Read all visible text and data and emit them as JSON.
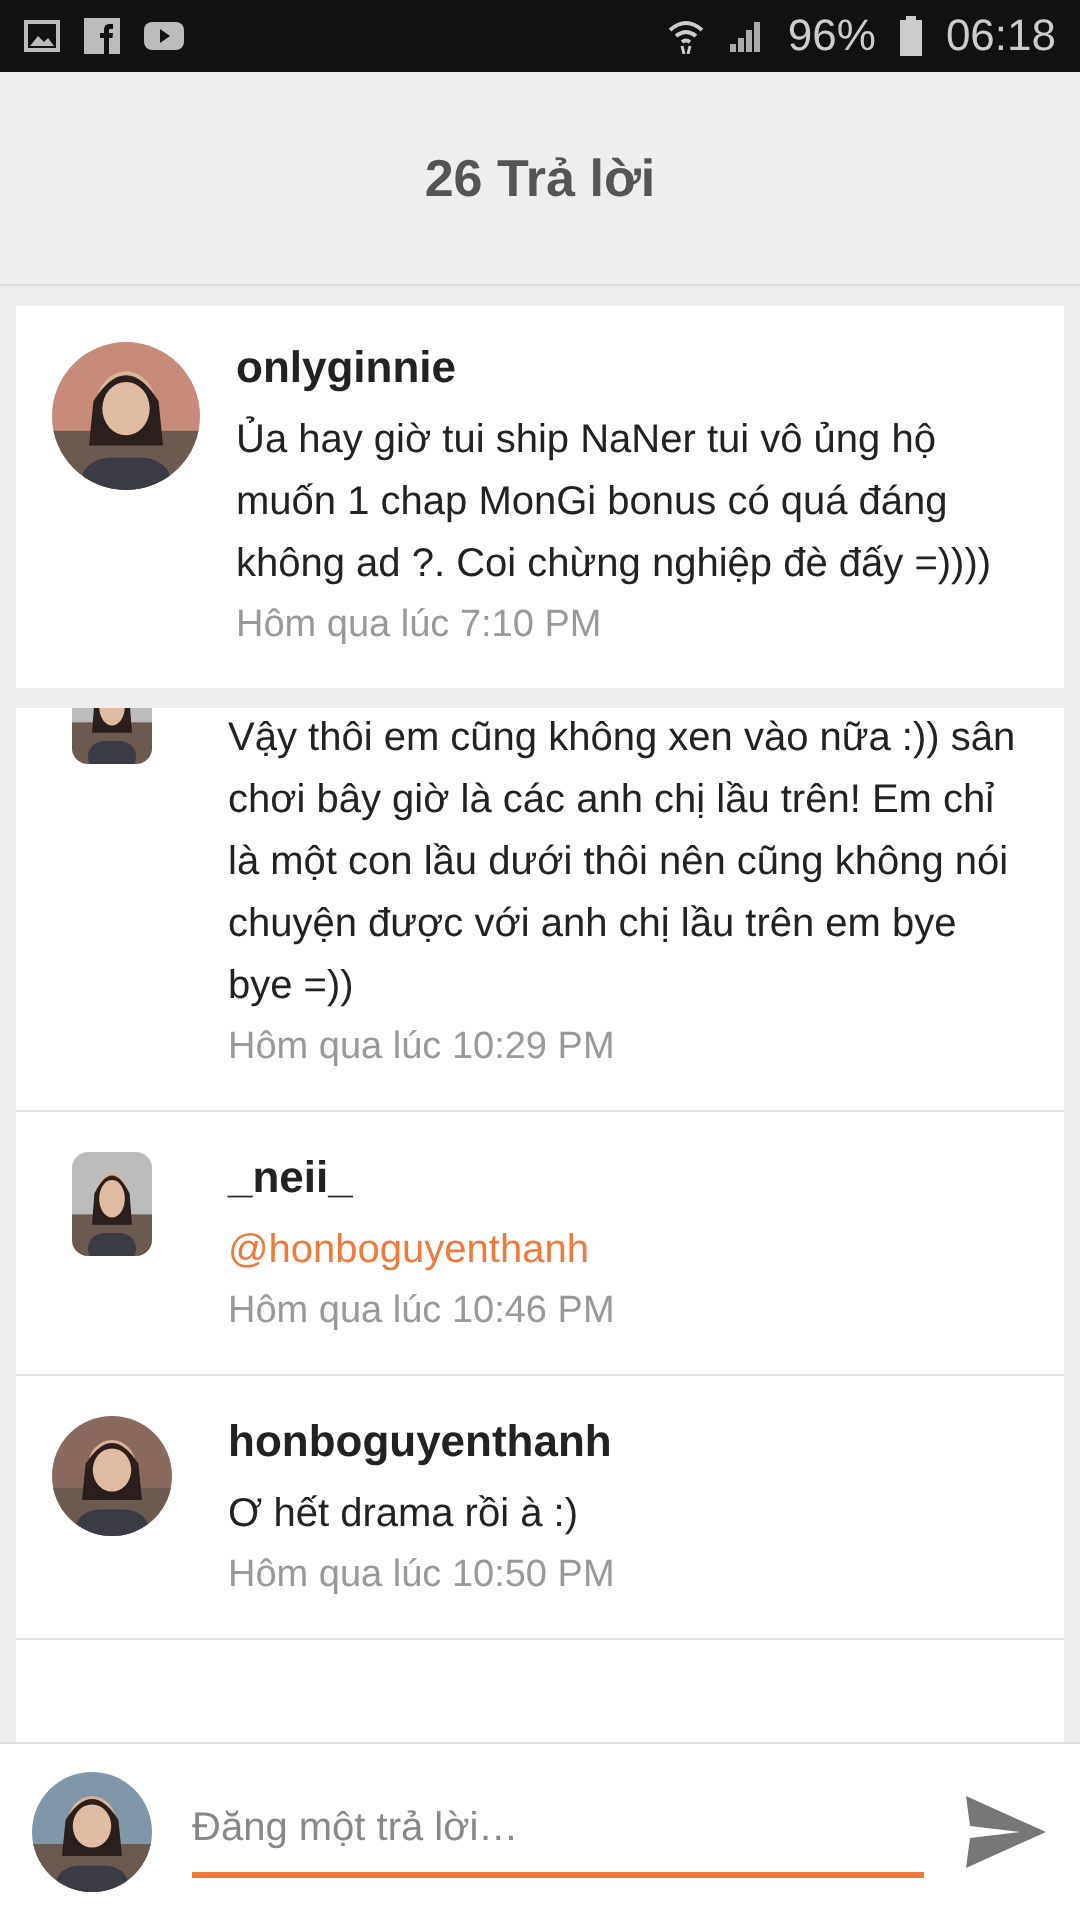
{
  "status_bar": {
    "battery": "96%",
    "time": "06:18"
  },
  "header": {
    "title": "26 Trả lời"
  },
  "comment": {
    "author": "onlyginnie",
    "text": "Ủa hay giờ tui ship NaNer tui vô ủng hộ muốn 1 chap MonGi bonus có quá đáng không ad ?. Coi chừng nghiệp đè đấy =))))",
    "time": "Hôm qua lúc 7:10 PM"
  },
  "replies": [
    {
      "round_avatar": false,
      "text": "Vậy thôi em cũng không xen vào nữa :)) sân chơi bây giờ là các anh chị lầu trên! Em chỉ là một con lầu dưới thôi nên cũng không nói chuyện được với anh chị lầu trên em bye bye =))",
      "time": "Hôm qua lúc 10:29 PM"
    },
    {
      "round_avatar": false,
      "author": "_neii_",
      "mention": "@honboguyenthanh",
      "time": "Hôm qua lúc 10:46 PM"
    },
    {
      "round_avatar": true,
      "author": "honboguyenthanh",
      "text": "Ơ hết drama rồi à :)",
      "time": "Hôm qua lúc 10:50 PM"
    }
  ],
  "composer": {
    "placeholder": "Đăng một trả lời…"
  }
}
